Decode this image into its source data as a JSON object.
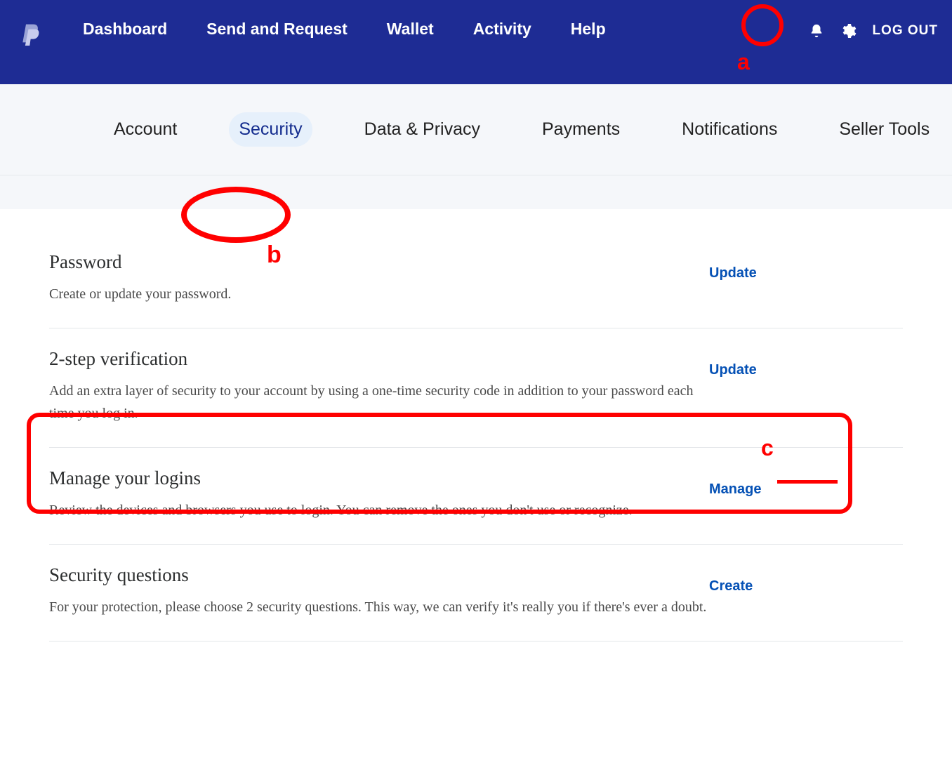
{
  "topnav": {
    "dashboard": "Dashboard",
    "send": "Send and Request",
    "wallet": "Wallet",
    "activity": "Activity",
    "help": "Help",
    "logout": "LOG OUT"
  },
  "subnav": {
    "account": "Account",
    "security": "Security",
    "data": "Data & Privacy",
    "payments": "Payments",
    "notifications": "Notifications",
    "seller": "Seller Tools"
  },
  "sections": {
    "password": {
      "title": "Password",
      "desc": "Create or update your password.",
      "action": "Update"
    },
    "twostep": {
      "title": "2-step verification",
      "desc": "Add an extra layer of security to your account by using a one-time security code in addition to your password each time you log in.",
      "action": "Update"
    },
    "logins": {
      "title": "Manage your logins",
      "desc": "Review the devices and browsers you use to login. You can remove the ones you don't use or recognize.",
      "action": "Manage"
    },
    "questions": {
      "title": "Security questions",
      "desc": "For your protection, please choose 2 security questions. This way, we can verify it's really you if there's ever a doubt.",
      "action": "Create"
    }
  },
  "annotations": {
    "a": "a",
    "b": "b",
    "c": "c"
  }
}
